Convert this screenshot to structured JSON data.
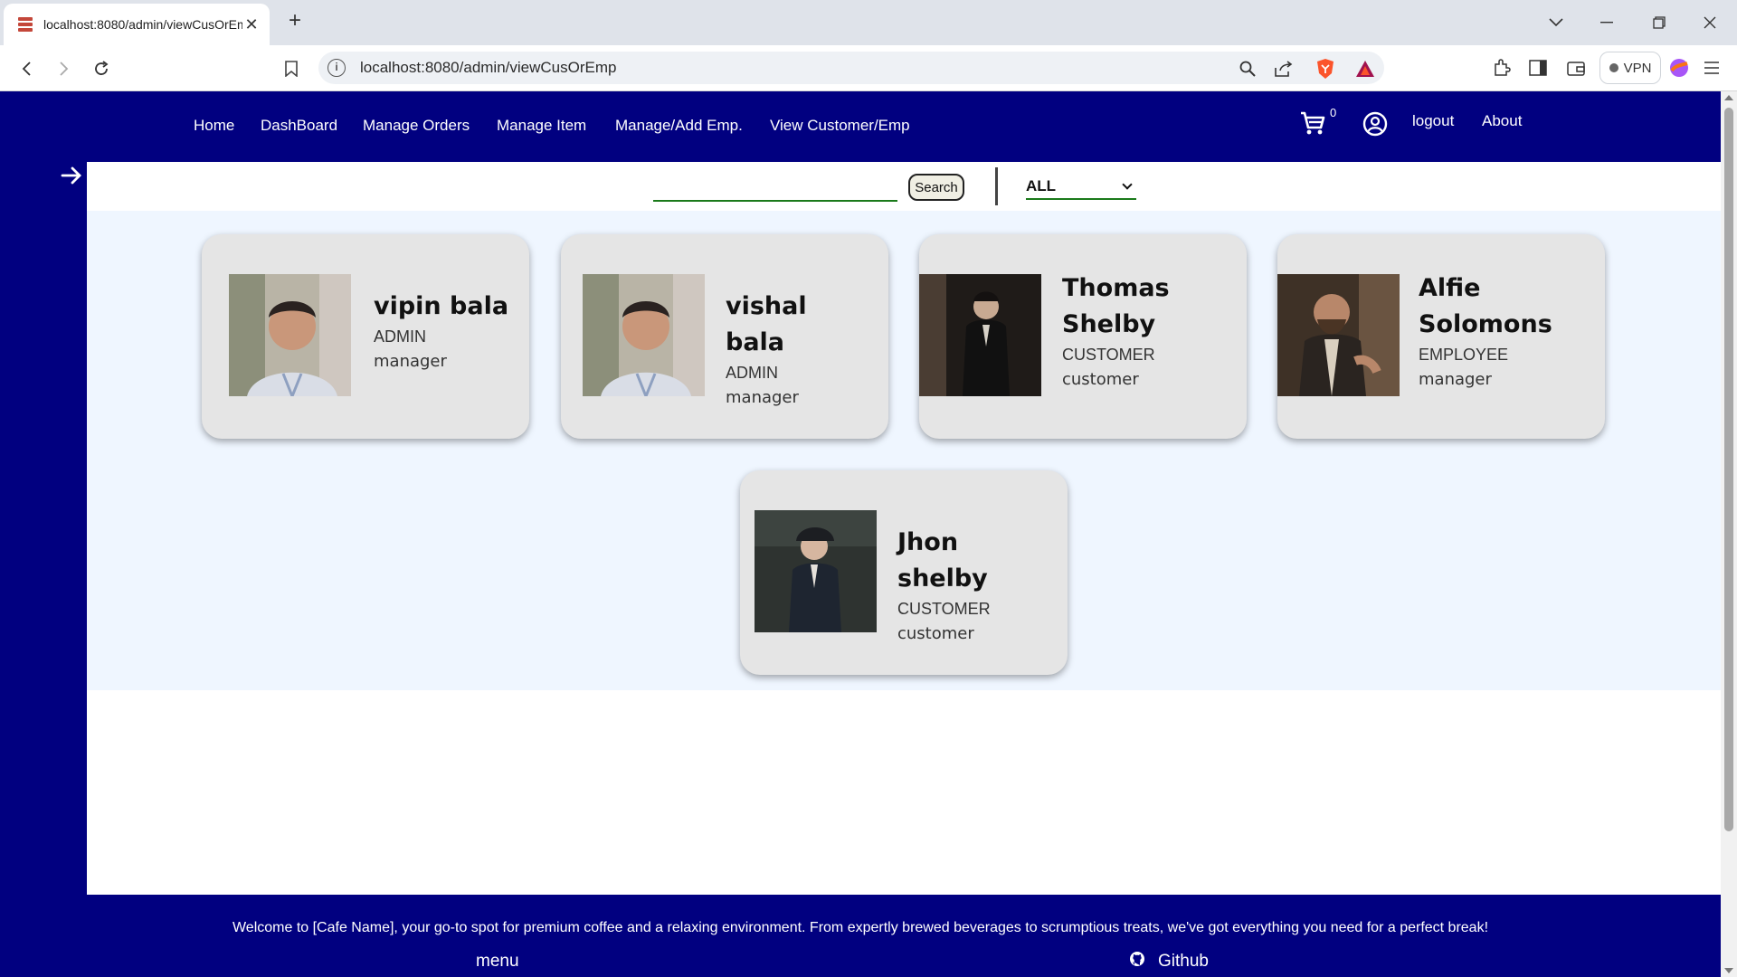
{
  "browser": {
    "tab_title": "localhost:8080/admin/viewCusOrEmp",
    "url": "localhost:8080/admin/viewCusOrEmp",
    "vpn_label": "VPN"
  },
  "nav": {
    "links": [
      "Home",
      "DashBoard",
      "Manage Orders",
      "Manage Item",
      "Manage/Add Emp.",
      "View Customer/Emp"
    ],
    "cart_count": "0",
    "logout": "logout",
    "about": "About"
  },
  "search": {
    "value": "",
    "button": "Search",
    "filter": "ALL"
  },
  "people": [
    {
      "name": "vipin bala",
      "role": "ADMIN",
      "position": "manager",
      "photo": "portrait-man-striped-shirt"
    },
    {
      "name": "vishal bala",
      "role": "ADMIN",
      "position": "manager",
      "photo": "portrait-man-striped-shirt"
    },
    {
      "name": "Thomas Shelby",
      "role": "CUSTOMER",
      "position": "customer",
      "photo": "portrait-man-dark-suit"
    },
    {
      "name": "Alfie Solomons",
      "role": "EMPLOYEE",
      "position": "manager",
      "photo": "portrait-bearded-man"
    },
    {
      "name": "Jhon shelby",
      "role": "CUSTOMER",
      "position": "customer",
      "photo": "portrait-man-flat-cap"
    }
  ],
  "footer": {
    "text": "Welcome to [Cafe Name], your go-to spot for premium coffee and a relaxing environment. From expertly brewed beverages to scrumptious treats, we've got everything you need for a perfect break!",
    "menu": "menu",
    "github": "Github"
  },
  "colors": {
    "nav_bg": "#010080",
    "grid_bg": "#eff6ff",
    "card_bg": "#e5e5e5",
    "underline": "#1a7a1a"
  }
}
